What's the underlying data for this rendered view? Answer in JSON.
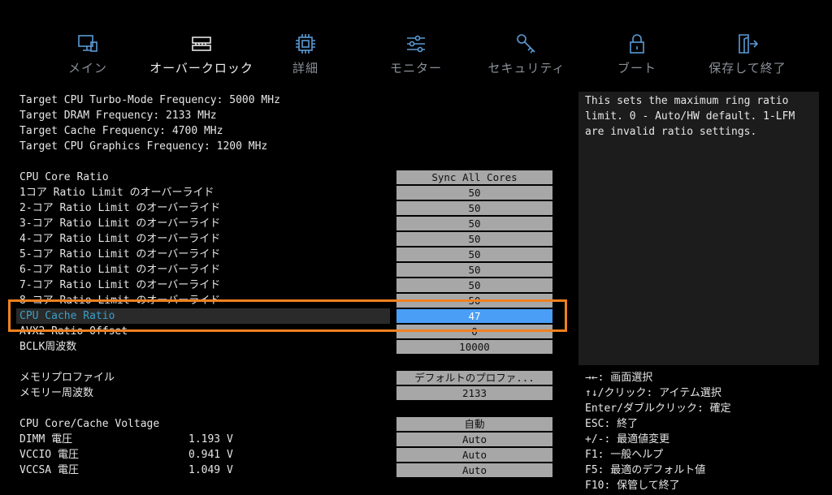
{
  "tabs": [
    {
      "label": "メイン",
      "icon": "monitor-icon"
    },
    {
      "label": "オーバークロック",
      "icon": "memory-chip-icon",
      "active": true
    },
    {
      "label": "詳細",
      "icon": "cpu-icon"
    },
    {
      "label": "モニター",
      "icon": "sliders-icon"
    },
    {
      "label": "セキュリティ",
      "icon": "key-icon"
    },
    {
      "label": "ブート",
      "icon": "lock-icon"
    },
    {
      "label": "保存して終了",
      "icon": "exit-icon"
    }
  ],
  "info": [
    "Target CPU Turbo-Mode Frequency: 5000 MHz",
    "Target DRAM Frequency: 2133 MHz",
    "Target Cache Frequency: 4700 MHz",
    "Target CPU Graphics Frequency: 1200 MHz"
  ],
  "ratio_settings": [
    {
      "label": "CPU Core Ratio",
      "value": "Sync All Cores"
    },
    {
      "label": "1コア Ratio Limit のオーバーライド",
      "value": "50"
    },
    {
      "label": "2-コア Ratio Limit のオーバーライド",
      "value": "50"
    },
    {
      "label": "3-コア Ratio Limit のオーバーライド",
      "value": "50"
    },
    {
      "label": "4-コア Ratio Limit のオーバーライド",
      "value": "50"
    },
    {
      "label": "5-コア Ratio Limit のオーバーライド",
      "value": "50"
    },
    {
      "label": "6-コア Ratio Limit のオーバーライド",
      "value": "50"
    },
    {
      "label": "7-コア Ratio Limit のオーバーライド",
      "value": "50"
    },
    {
      "label": "8-コア Ratio Limit のオーバーライド",
      "value": "50"
    },
    {
      "label": "CPU Cache Ratio",
      "value": "47"
    },
    {
      "label": "AVX2 Ratio Offset",
      "value": "0"
    },
    {
      "label": "BCLK周波数",
      "value": "10000"
    }
  ],
  "memory_settings": [
    {
      "label": "メモリプロファイル",
      "value": "デフォルトのプロファ..."
    },
    {
      "label": "メモリー周波数",
      "value": "2133"
    }
  ],
  "voltage_header": {
    "label": "CPU Core/Cache Voltage",
    "value": "自動"
  },
  "voltage_settings": [
    {
      "label": "DIMM 電圧",
      "reading": "1.193 V",
      "value": "Auto"
    },
    {
      "label": "VCCIO 電圧",
      "reading": "0.941 V",
      "value": "Auto"
    },
    {
      "label": "VCCSA 電圧",
      "reading": "1.049 V",
      "value": "Auto"
    }
  ],
  "help_text": "This sets the maximum ring ratio limit. 0 - Auto/HW default. 1-LFM are invalid ratio settings.",
  "key_help": [
    "→←: 画面選択",
    "↑↓/クリック: アイテム選択",
    "Enter/ダブルクリック: 確定",
    "ESC: 終了",
    "+/-: 最適値変更",
    "F1: 一般ヘルプ",
    "F5: 最適のデフォルト値",
    "F10: 保管して終了"
  ],
  "colors": {
    "highlight": "#f08020",
    "selected_field": "#4a9ef5",
    "icon": "#5b9bd5"
  }
}
